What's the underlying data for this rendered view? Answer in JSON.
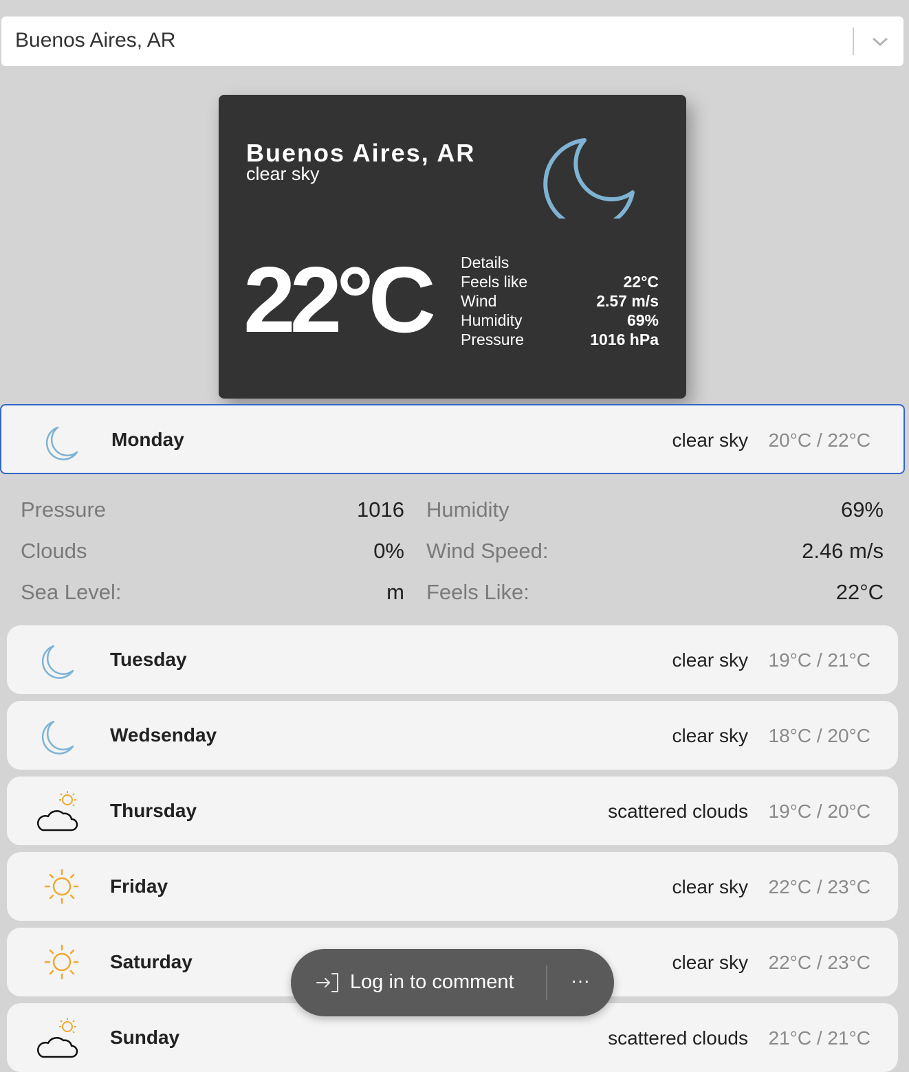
{
  "location_select": {
    "value": "Buenos Aires, AR"
  },
  "current": {
    "city": "Buenos Aires, AR",
    "description": "clear sky",
    "temperature": "22°C",
    "icon": "moon-icon",
    "details_title": "Details",
    "details": [
      {
        "label": "Feels like",
        "value": "22°C"
      },
      {
        "label": "Wind",
        "value": "2.57 m/s"
      },
      {
        "label": "Humidity",
        "value": "69%"
      },
      {
        "label": "Pressure",
        "value": "1016 hPa"
      }
    ]
  },
  "forecast": [
    {
      "day": "Monday",
      "condition": "clear sky",
      "range": "20°C / 22°C",
      "icon": "moon-icon",
      "selected": true
    },
    {
      "day": "Tuesday",
      "condition": "clear sky",
      "range": "19°C / 21°C",
      "icon": "moon-icon"
    },
    {
      "day": "Wedsenday",
      "condition": "clear sky",
      "range": "18°C / 20°C",
      "icon": "moon-icon"
    },
    {
      "day": "Thursday",
      "condition": "scattered clouds",
      "range": "19°C / 20°C",
      "icon": "cloud-sun-icon"
    },
    {
      "day": "Friday",
      "condition": "clear sky",
      "range": "22°C / 23°C",
      "icon": "sun-icon"
    },
    {
      "day": "Saturday",
      "condition": "clear sky",
      "range": "22°C / 23°C",
      "icon": "sun-icon"
    },
    {
      "day": "Sunday",
      "condition": "scattered clouds",
      "range": "21°C / 21°C",
      "icon": "cloud-sun-icon"
    }
  ],
  "expanded_details": {
    "pressure_label": "Pressure",
    "pressure_value": "1016",
    "humidity_label": "Humidity",
    "humidity_value": "69%",
    "clouds_label": "Clouds",
    "clouds_value": "0%",
    "wind_label": "Wind Speed:",
    "wind_value": "2.46 m/s",
    "sea_label": "Sea Level:",
    "sea_value": "m",
    "feels_label": "Feels Like:",
    "feels_value": "22°C"
  },
  "comment_bar": {
    "label": "Log in to comment",
    "more": "···"
  },
  "colors": {
    "moon": "#7fb3d3",
    "sun": "#f0a830",
    "card_bg": "#333333",
    "selected_border": "#2f66c9"
  }
}
